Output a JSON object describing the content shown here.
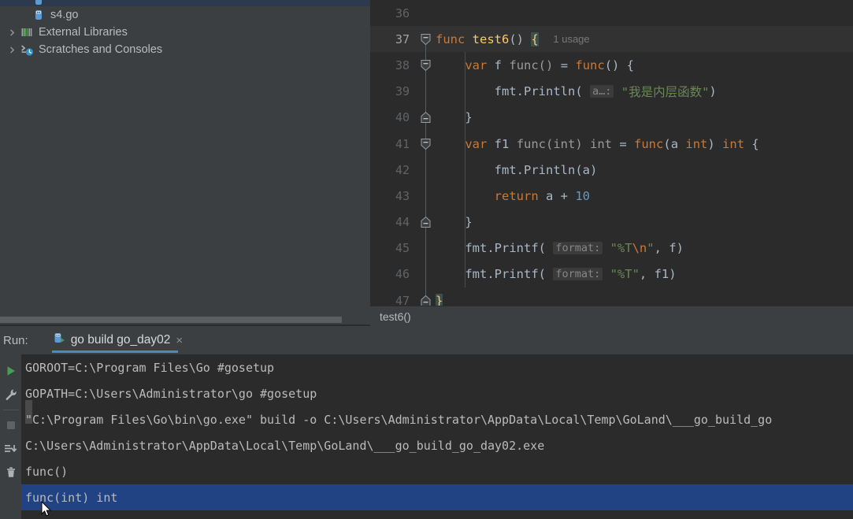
{
  "project_tree": {
    "rows": [
      {
        "label": "",
        "icon": "go-file-icon",
        "indent": 2,
        "state": "selected-partial"
      },
      {
        "label": "s4.go",
        "icon": "go-file-icon",
        "indent": 2,
        "state": "normal"
      },
      {
        "label": "External Libraries",
        "icon": "libraries-icon",
        "indent": 1,
        "state": "normal",
        "arrow": "chevron-right"
      },
      {
        "label": "Scratches and Consoles",
        "icon": "scratches-icon",
        "indent": 1,
        "state": "normal",
        "arrow": "chevron-right"
      }
    ]
  },
  "editor": {
    "breadcrumb": "test6()",
    "lines": [
      {
        "num": "36",
        "current": false,
        "tokens": []
      },
      {
        "num": "37",
        "current": true,
        "tokens": [
          {
            "t": "func",
            "c": "kw"
          },
          {
            "t": " ",
            "c": "plain"
          },
          {
            "t": "test6",
            "c": "fn"
          },
          {
            "t": "()",
            "c": "plain"
          },
          {
            "t": " ",
            "c": "plain"
          },
          {
            "t": "{",
            "c": "brace-hl"
          },
          {
            "t": "  ",
            "c": "plain"
          },
          {
            "t": "1 usage",
            "c": "usage"
          }
        ]
      },
      {
        "num": "38",
        "current": false,
        "indent": 1,
        "tokens": [
          {
            "t": "    ",
            "c": "plain"
          },
          {
            "t": "var",
            "c": "kw"
          },
          {
            "t": " ",
            "c": "plain"
          },
          {
            "t": "f",
            "c": "ident"
          },
          {
            "t": " ",
            "c": "plain"
          },
          {
            "t": "func()",
            "c": "typ"
          },
          {
            "t": " = ",
            "c": "plain"
          },
          {
            "t": "func",
            "c": "kw"
          },
          {
            "t": "() {",
            "c": "plain"
          }
        ]
      },
      {
        "num": "39",
        "current": false,
        "indent": 2,
        "tokens": [
          {
            "t": "        ",
            "c": "plain"
          },
          {
            "t": "fmt",
            "c": "pkg"
          },
          {
            "t": ".",
            "c": "plain"
          },
          {
            "t": "Println",
            "c": "meth"
          },
          {
            "t": "( ",
            "c": "plain"
          },
          {
            "t": "a…:",
            "c": "hint"
          },
          {
            "t": " ",
            "c": "plain"
          },
          {
            "t": "\"我是内层函数\"",
            "c": "str"
          },
          {
            "t": ")",
            "c": "plain"
          }
        ]
      },
      {
        "num": "40",
        "current": false,
        "indent": 1,
        "tokens": [
          {
            "t": "    }",
            "c": "plain"
          }
        ]
      },
      {
        "num": "41",
        "current": false,
        "indent": 1,
        "tokens": [
          {
            "t": "    ",
            "c": "plain"
          },
          {
            "t": "var",
            "c": "kw"
          },
          {
            "t": " ",
            "c": "plain"
          },
          {
            "t": "f1",
            "c": "ident"
          },
          {
            "t": " ",
            "c": "plain"
          },
          {
            "t": "func(int) int",
            "c": "typ"
          },
          {
            "t": " = ",
            "c": "plain"
          },
          {
            "t": "func",
            "c": "kw"
          },
          {
            "t": "(",
            "c": "plain"
          },
          {
            "t": "a",
            "c": "ident"
          },
          {
            "t": " ",
            "c": "plain"
          },
          {
            "t": "int",
            "c": "kw"
          },
          {
            "t": ") ",
            "c": "plain"
          },
          {
            "t": "int",
            "c": "kw"
          },
          {
            "t": " {",
            "c": "plain"
          }
        ]
      },
      {
        "num": "42",
        "current": false,
        "indent": 2,
        "tokens": [
          {
            "t": "        ",
            "c": "plain"
          },
          {
            "t": "fmt",
            "c": "pkg"
          },
          {
            "t": ".",
            "c": "plain"
          },
          {
            "t": "Println",
            "c": "meth"
          },
          {
            "t": "(",
            "c": "plain"
          },
          {
            "t": "a",
            "c": "ident"
          },
          {
            "t": ")",
            "c": "plain"
          }
        ]
      },
      {
        "num": "43",
        "current": false,
        "indent": 2,
        "tokens": [
          {
            "t": "        ",
            "c": "plain"
          },
          {
            "t": "return",
            "c": "kw"
          },
          {
            "t": " ",
            "c": "plain"
          },
          {
            "t": "a",
            "c": "ident"
          },
          {
            "t": " + ",
            "c": "plain"
          },
          {
            "t": "10",
            "c": "num"
          }
        ]
      },
      {
        "num": "44",
        "current": false,
        "indent": 1,
        "tokens": [
          {
            "t": "    }",
            "c": "plain"
          }
        ]
      },
      {
        "num": "45",
        "current": false,
        "indent": 1,
        "tokens": [
          {
            "t": "    ",
            "c": "plain"
          },
          {
            "t": "fmt",
            "c": "pkg"
          },
          {
            "t": ".",
            "c": "plain"
          },
          {
            "t": "Printf",
            "c": "meth"
          },
          {
            "t": "( ",
            "c": "plain"
          },
          {
            "t": "format:",
            "c": "hint"
          },
          {
            "t": " ",
            "c": "plain"
          },
          {
            "t": "\"%T\\n\"",
            "c": "str-esc"
          },
          {
            "t": ", ",
            "c": "plain"
          },
          {
            "t": "f",
            "c": "ident"
          },
          {
            "t": ")",
            "c": "plain"
          }
        ]
      },
      {
        "num": "46",
        "current": false,
        "indent": 1,
        "tokens": [
          {
            "t": "    ",
            "c": "plain"
          },
          {
            "t": "fmt",
            "c": "pkg"
          },
          {
            "t": ".",
            "c": "plain"
          },
          {
            "t": "Printf",
            "c": "meth"
          },
          {
            "t": "( ",
            "c": "plain"
          },
          {
            "t": "format:",
            "c": "hint"
          },
          {
            "t": " ",
            "c": "plain"
          },
          {
            "t": "\"%T\"",
            "c": "str"
          },
          {
            "t": ", ",
            "c": "plain"
          },
          {
            "t": "f1",
            "c": "ident"
          },
          {
            "t": ")",
            "c": "plain"
          }
        ]
      },
      {
        "num": "47",
        "current": false,
        "tokens": [
          {
            "t": "}",
            "c": "brace-hl"
          }
        ]
      }
    ]
  },
  "run_panel": {
    "title": "Run:",
    "tab": {
      "label": "go build go_day02",
      "close": "×",
      "icon": "go-run-icon"
    },
    "toolbar": [
      {
        "name": "rerun-button",
        "icon": "play-icon"
      },
      {
        "name": "edit-configurations-button",
        "icon": "wrench-icon"
      },
      {
        "name": "stop-button",
        "icon": "stop-icon"
      },
      {
        "name": "scroll-to-end-button",
        "icon": "scroll-end-icon"
      },
      {
        "name": "clear-all-button",
        "icon": "trash-icon"
      }
    ],
    "console_lines": [
      {
        "text": "GOROOT=C:\\Program Files\\Go #gosetup",
        "selected": false
      },
      {
        "text": "GOPATH=C:\\Users\\Administrator\\go #gosetup",
        "selected": false
      },
      {
        "text": "\"C:\\Program Files\\Go\\bin\\go.exe\" build -o C:\\Users\\Administrator\\AppData\\Local\\Temp\\GoLand\\___go_build_go",
        "selected": false
      },
      {
        "text": "C:\\Users\\Administrator\\AppData\\Local\\Temp\\GoLand\\___go_build_go_day02.exe",
        "selected": false
      },
      {
        "text": "func()",
        "selected": false
      },
      {
        "text": "func(int) int",
        "selected": true
      }
    ]
  },
  "colors": {
    "panel_bg": "#3c3f41",
    "editor_bg": "#2b2b2b",
    "current_line_bg": "#323232",
    "selection_blue": "#214283",
    "tab_underline": "#4a88c7",
    "tree_selected": "#2d3a4d",
    "keyword_orange": "#cc7832",
    "function_yellow": "#ffc66d",
    "string_green": "#6a8759",
    "number_blue": "#6897bb",
    "text_gray": "#a9b7c6"
  }
}
